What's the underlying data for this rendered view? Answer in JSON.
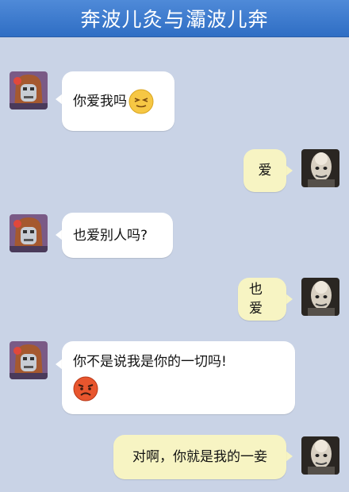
{
  "header": {
    "title_left": "奔波儿灸",
    "title_right": "灞波儿奔"
  },
  "messages": [
    {
      "side": "left",
      "text": "你爱我吗",
      "emoji": "smiling-closed-eyes-icon"
    },
    {
      "side": "right",
      "text": "爱"
    },
    {
      "side": "left",
      "text": "也爱别人吗?"
    },
    {
      "side": "right",
      "text": "也爱"
    },
    {
      "side": "left",
      "text": "你不是说我是你的一切吗!",
      "emoji": "angry-face-icon"
    },
    {
      "side": "right",
      "text": "对啊，你就是我的一妾"
    }
  ],
  "colors": {
    "titlebar": "#3a78cc",
    "background": "#c9d3e6",
    "incoming": "#ffffff",
    "outgoing": "#f7f4c3"
  }
}
